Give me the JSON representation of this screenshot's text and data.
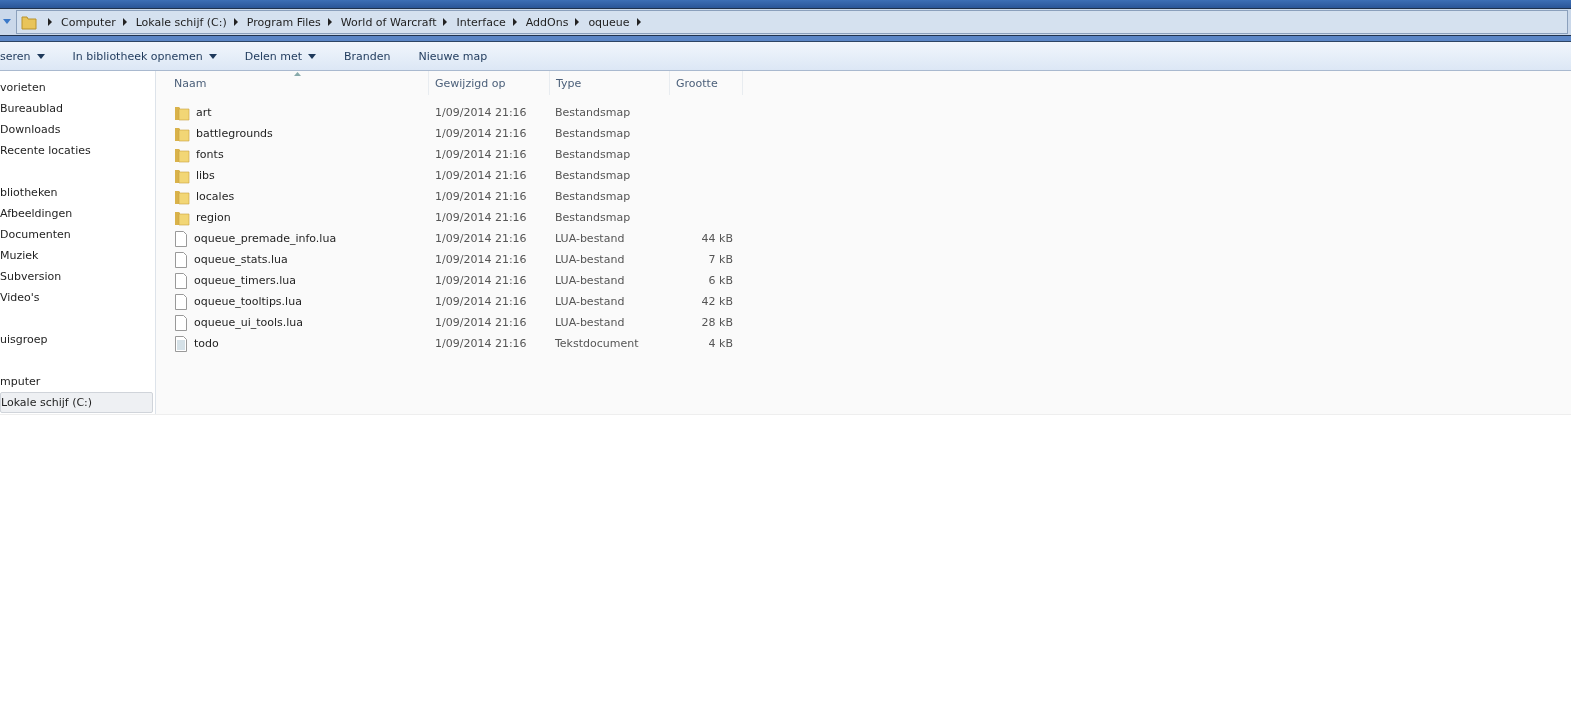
{
  "address_bar": {
    "crumbs": [
      "Computer",
      "Lokale schijf (C:)",
      "Program Files",
      "World of Warcraft",
      "Interface",
      "AddOns",
      "oqueue"
    ]
  },
  "toolbar": [
    {
      "label": "seren",
      "dropdown": true
    },
    {
      "label": "In bibliotheek opnemen",
      "dropdown": true
    },
    {
      "label": "Delen met",
      "dropdown": true
    },
    {
      "label": "Branden",
      "dropdown": false
    },
    {
      "label": "Nieuwe map",
      "dropdown": false
    }
  ],
  "sidebar": {
    "groups": [
      {
        "label": "vorieten",
        "selected": false,
        "children": [
          {
            "label": "Bureaublad",
            "selected": false
          },
          {
            "label": "Downloads",
            "selected": false
          },
          {
            "label": "Recente locaties",
            "selected": false
          }
        ]
      },
      {
        "label": "bliotheken",
        "selected": false,
        "children": [
          {
            "label": "Afbeeldingen",
            "selected": false
          },
          {
            "label": "Documenten",
            "selected": false
          },
          {
            "label": "Muziek",
            "selected": false
          },
          {
            "label": "Subversion",
            "selected": false
          },
          {
            "label": "Video's",
            "selected": false
          }
        ]
      },
      {
        "label": "uisgroep",
        "selected": false
      },
      {
        "label": "mputer",
        "selected": false,
        "children": [
          {
            "label": "Lokale schijf (C:)",
            "selected": true
          }
        ]
      }
    ]
  },
  "table": {
    "columns": [
      "Naam",
      "Gewijzigd op",
      "Type",
      "Grootte"
    ],
    "rows": [
      {
        "kind": "folder",
        "name": "art",
        "modified": "1/09/2014 21:16",
        "type": "Bestandsmap"
      },
      {
        "kind": "folder",
        "name": "battlegrounds",
        "modified": "1/09/2014 21:16",
        "type": "Bestandsmap"
      },
      {
        "kind": "folder",
        "name": "fonts",
        "modified": "1/09/2014 21:16",
        "type": "Bestandsmap"
      },
      {
        "kind": "folder",
        "name": "libs",
        "modified": "1/09/2014 21:16",
        "type": "Bestandsmap"
      },
      {
        "kind": "folder",
        "name": "locales",
        "modified": "1/09/2014 21:16",
        "type": "Bestandsmap"
      },
      {
        "kind": "folder",
        "name": "region",
        "modified": "1/09/2014 21:16",
        "type": "Bestandsmap"
      },
      {
        "kind": "file",
        "name": "oqueue_premade_info.lua",
        "modified": "1/09/2014 21:16",
        "type": "LUA-bestand",
        "size": "44 kB"
      },
      {
        "kind": "file",
        "name": "oqueue_stats.lua",
        "modified": "1/09/2014 21:16",
        "type": "LUA-bestand",
        "size": "7 kB"
      },
      {
        "kind": "file",
        "name": "oqueue_timers.lua",
        "modified": "1/09/2014 21:16",
        "type": "LUA-bestand",
        "size": "6 kB"
      },
      {
        "kind": "file",
        "name": "oqueue_tooltips.lua",
        "modified": "1/09/2014 21:16",
        "type": "LUA-bestand",
        "size": "42 kB"
      },
      {
        "kind": "file",
        "name": "oqueue_ui_tools.lua",
        "modified": "1/09/2014 21:16",
        "type": "LUA-bestand",
        "size": "28 kB"
      },
      {
        "kind": "text",
        "name": "todo",
        "modified": "1/09/2014 21:16",
        "type": "Tekstdocument",
        "size": "4 kB"
      }
    ]
  }
}
